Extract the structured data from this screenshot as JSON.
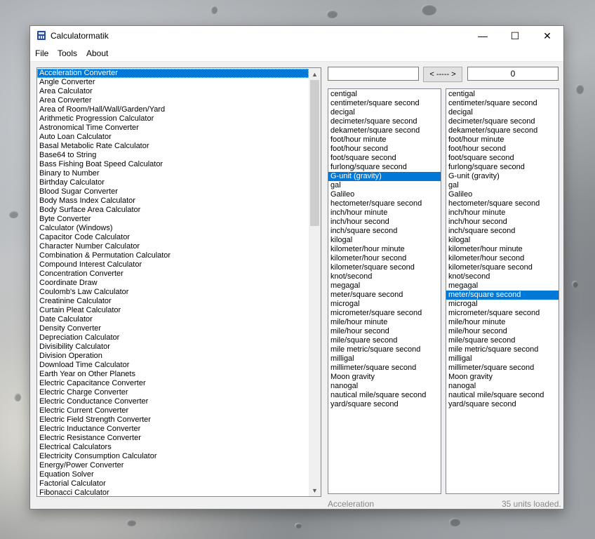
{
  "window": {
    "title": "Calculatormatik",
    "minimize": "—",
    "maximize": "☐",
    "close": "✕"
  },
  "menu": [
    "File",
    "Tools",
    "About"
  ],
  "calculators": [
    "Acceleration Converter",
    "Angle Converter",
    "Area Calculator",
    "Area Converter",
    "Area of Room/Hall/Wall/Garden/Yard",
    "Arithmetic Progression Calculator",
    "Astronomical Time Converter",
    "Auto Loan Calculator",
    "Basal Metabolic Rate Calculator",
    "Base64 to String",
    "Bass Fishing Boat Speed Calculator",
    "Binary to Number",
    "Birthday Calculator",
    "Blood Sugar Converter",
    "Body Mass Index Calculator",
    "Body Surface Area Calculator",
    "Byte Converter",
    "Calculator (Windows)",
    "Capacitor Code Calculator",
    "Character Number Calculator",
    "Combination & Permutation Calculator",
    "Compound Interest Calculator",
    "Concentration Converter",
    "Coordinate Draw",
    "Coulomb's Law Calculator",
    "Creatinine Calculator",
    "Curtain Pleat Calculator",
    "Date Calculator",
    "Density Converter",
    "Depreciation Calculator",
    "Divisibility Calculator",
    "Division Operation",
    "Download Time Calculator",
    "Earth Year on Other Planets",
    "Electric Capacitance Converter",
    "Electric Charge Converter",
    "Electric Conductance Converter",
    "Electric Current Converter",
    "Electric Field Strength Converter",
    "Electric Inductance Converter",
    "Electric Resistance Converter",
    "Electrical Calculators",
    "Electricity Consumption Calculator",
    "Energy/Power Converter",
    "Equation Solver",
    "Factorial Calculator",
    "Fibonacci Calculator"
  ],
  "selected_calculator_index": 0,
  "units": [
    "centigal",
    "centimeter/square second",
    "decigal",
    "decimeter/square second",
    "dekameter/square second",
    "foot/hour minute",
    "foot/hour second",
    "foot/square second",
    "furlong/square second",
    "G-unit (gravity)",
    "gal",
    "Galileo",
    "hectometer/square second",
    "inch/hour minute",
    "inch/hour second",
    "inch/square second",
    "kilogal",
    "kilometer/hour minute",
    "kilometer/hour second",
    "kilometer/square second",
    "knot/second",
    "megagal",
    "meter/square second",
    "microgal",
    "micrometer/square second",
    "mile/hour minute",
    "mile/hour second",
    "mile/square second",
    "mile metric/square second",
    "milligal",
    "millimeter/square second",
    "Moon gravity",
    "nanogal",
    "nautical mile/square second",
    "yard/square second"
  ],
  "from_selected_index": 9,
  "to_selected_index": 22,
  "from_value": "",
  "swap_label": "< ----- >",
  "to_value": "0",
  "status_left": "Acceleration",
  "status_right": "35 units loaded."
}
